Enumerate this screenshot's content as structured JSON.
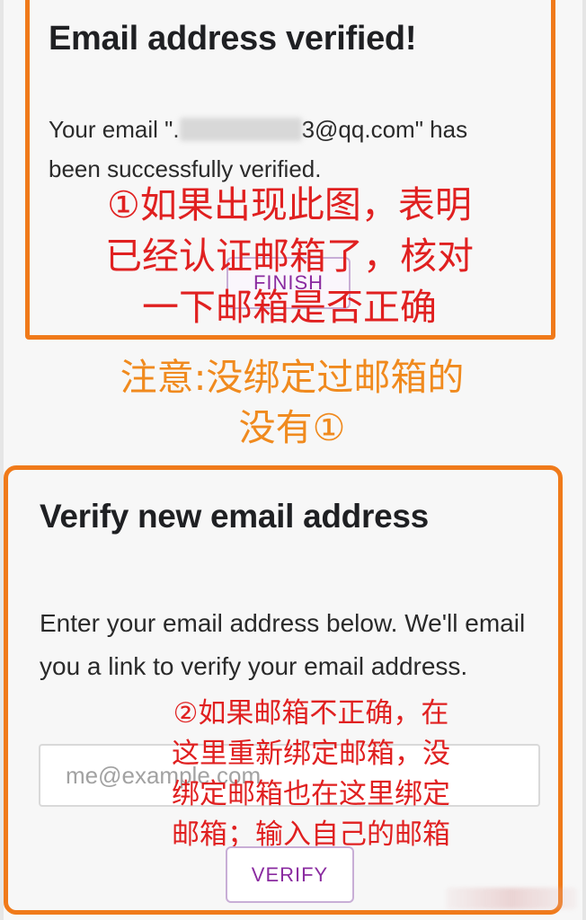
{
  "verified_card": {
    "title": "Email address verified!",
    "message_prefix": "Your email \".",
    "message_suffix": "3@qq.com\" has been successfully verified.",
    "finish_button": "FINISH"
  },
  "annotations": {
    "note1_line1": "①如果出现此图，表明",
    "note1_line2": "已经认证邮箱了，核对",
    "note1_line3": "一下邮箱是否正确",
    "middle_line1": "注意:没绑定过邮箱的",
    "middle_line2": "没有①",
    "note2_line1": "②如果邮箱不正确，在",
    "note2_line2": "这里重新绑定邮箱，没",
    "note2_line3": "绑定邮箱也在这里绑定",
    "note2_line4": "邮箱；输入自己的邮箱"
  },
  "verify_card": {
    "title": "Verify new email address",
    "description": "Enter your email address below. We'll email you a link to verify your email address.",
    "email_placeholder": "me@example.com",
    "verify_button": "VERIFY"
  },
  "colors": {
    "highlight_border": "#f07a1a",
    "annotation_red": "#e02020",
    "annotation_orange": "#f08a1e",
    "button_text": "#8a2ba0"
  }
}
